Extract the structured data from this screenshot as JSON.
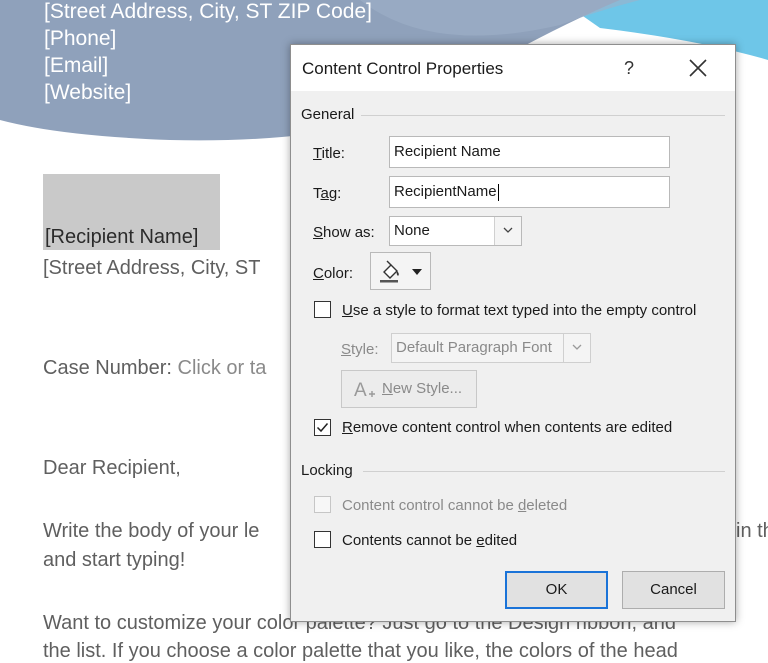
{
  "document": {
    "header_lines": [
      "[Street Address, City, ST ZIP Code]",
      "[Phone]",
      "[Email]",
      "[Website]"
    ],
    "recipient_name": "[Recipient Name]",
    "recipient_address": "[Street Address, City, ST",
    "case_label": "Case Number: ",
    "case_placeholder": "Click or ta",
    "salutation": "Dear Recipient,",
    "body_line1": "Write the body of your le",
    "body_line1_right": "in th",
    "body_line2": "and start typing!",
    "body_line3": "Want to customize your color palette?  Just go to the Design ribbon, and",
    "body_line4": "the list.  If you choose a color palette that you like, the colors of the head"
  },
  "dialog": {
    "title": "Content Control Properties",
    "help_label": "?",
    "general_group": "General",
    "title_label_u": "T",
    "title_label_rest": "itle:",
    "title_value": "Recipient Name",
    "tag_label_pre": "T",
    "tag_label_u": "a",
    "tag_label_rest": "g:",
    "tag_value": "RecipientName",
    "showas_label_u": "S",
    "showas_label_rest": "how as:",
    "showas_value": "None",
    "color_label_u": "C",
    "color_label_rest": "olor:",
    "use_style_u": "U",
    "use_style_rest": "se a style to format text typed into the empty control",
    "style_label_u": "S",
    "style_label_rest": "tyle:",
    "style_value": "Default Paragraph Font",
    "new_style_u": "N",
    "new_style_rest": "ew Style...",
    "remove_u": "R",
    "remove_rest": "emove content control when contents are edited",
    "remove_checked": true,
    "locking_group": "Locking",
    "cannot_delete_pre": "Content control cannot be ",
    "cannot_delete_u": "d",
    "cannot_delete_rest": "eleted",
    "cannot_edit_pre": "Contents cannot be ",
    "cannot_edit_u": "e",
    "cannot_edit_rest": "dited",
    "ok_label": "OK",
    "cancel_label": "Cancel"
  },
  "colors": {
    "header_gray": "#8fa1bb",
    "header_blue": "#6ec6e8",
    "dialog_bg": "#f0f0f0",
    "default_button_border": "#1a73d8"
  }
}
